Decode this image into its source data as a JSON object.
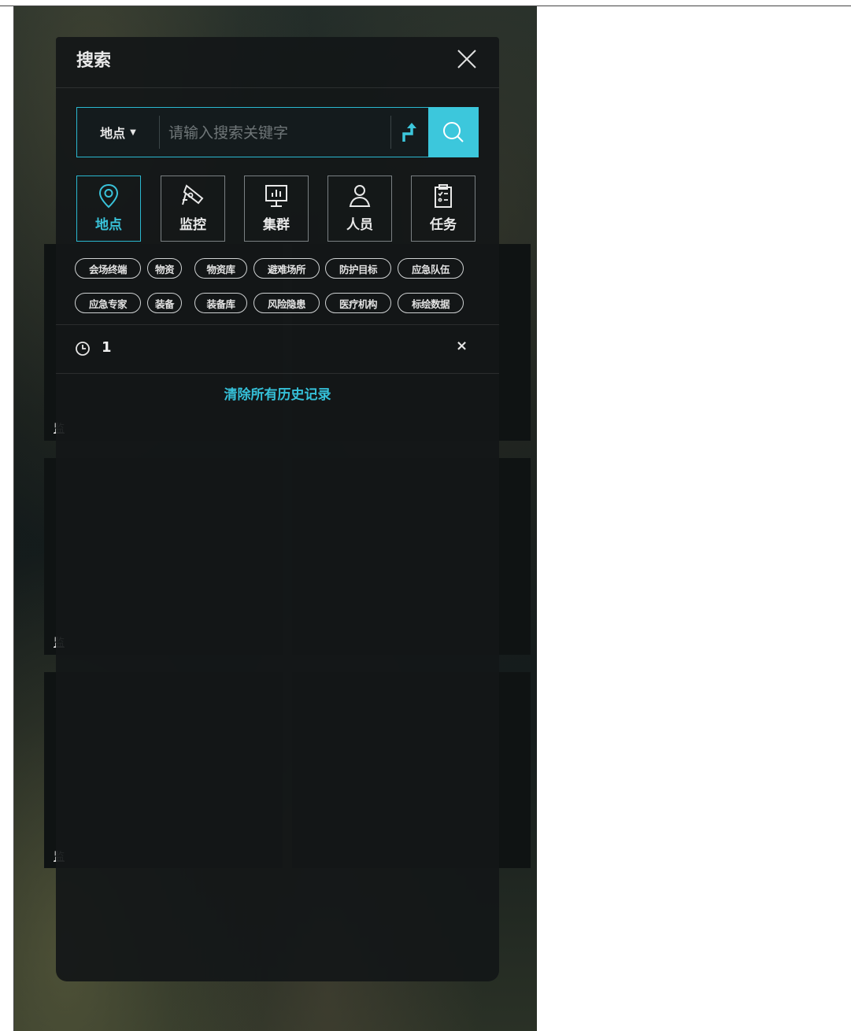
{
  "panel": {
    "title": "搜索"
  },
  "search": {
    "type_label": "地点",
    "placeholder": "请输入搜索关键字"
  },
  "categories": [
    {
      "label": "地点",
      "icon": "location-pin-icon",
      "active": true
    },
    {
      "label": "监控",
      "icon": "camera-icon",
      "active": false
    },
    {
      "label": "集群",
      "icon": "monitor-chart-icon",
      "active": false
    },
    {
      "label": "人员",
      "icon": "person-icon",
      "active": false
    },
    {
      "label": "任务",
      "icon": "clipboard-icon",
      "active": false
    }
  ],
  "tags_row1": [
    "会场终端",
    "物资",
    "物资库",
    "避难场所",
    "防护目标",
    "应急队伍"
  ],
  "tags_row2": [
    "应急专家",
    "装备",
    "装备库",
    "风险隐患",
    "医疗机构",
    "标绘数据"
  ],
  "history": {
    "items": [
      {
        "text": "1"
      }
    ],
    "clear_label": "清除所有历史记录"
  },
  "background_tiles": {
    "label": "监"
  },
  "colors": {
    "accent": "#3cc7dc",
    "panel_bg": "#131718",
    "border": "#7a8083"
  }
}
